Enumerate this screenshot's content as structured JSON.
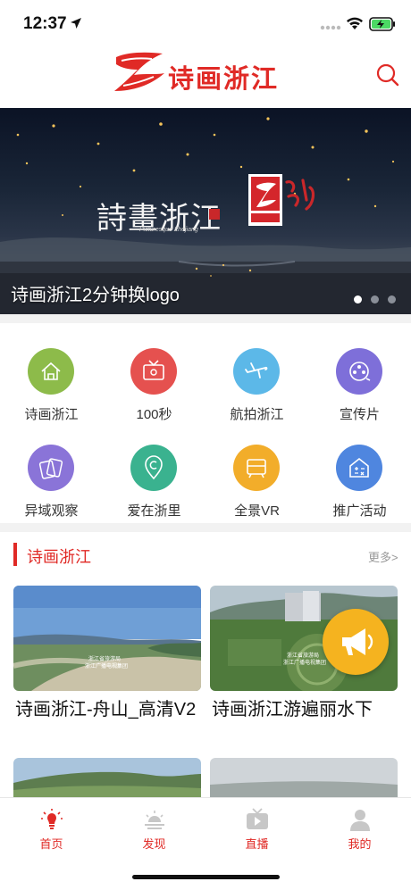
{
  "status_bar": {
    "time": "12:37"
  },
  "header": {
    "app_name": "诗画浙江"
  },
  "banner": {
    "caption": "诗画浙江2分钟换logo",
    "calligraphy": "詩畫浙江",
    "calligraphy_sub": "Picturesque Zhejiang",
    "slide_count": 3,
    "active_slide": 1
  },
  "grid": {
    "items": [
      {
        "label": "诗画浙江",
        "icon": "house-icon",
        "color": "#8dbb4a"
      },
      {
        "label": "100秒",
        "icon": "tv-icon",
        "color": "#e5514f"
      },
      {
        "label": "航拍浙江",
        "icon": "airplane-icon",
        "color": "#5cb8e8"
      },
      {
        "label": "宣传片",
        "icon": "film-reel-icon",
        "color": "#7e6fd9"
      },
      {
        "label": "异域观察",
        "icon": "cards-icon",
        "color": "#8a74d8"
      },
      {
        "label": "爱在浙里",
        "icon": "location-pin-icon",
        "color": "#3ab28f"
      },
      {
        "label": "全景VR",
        "icon": "vr-icon",
        "color": "#f2ad2a"
      },
      {
        "label": "推广活动",
        "icon": "calculator-icon",
        "color": "#4f86df"
      }
    ]
  },
  "section": {
    "title": "诗画浙江",
    "more": "更多>"
  },
  "cards": [
    {
      "title": "诗画浙江-舟山_高清V2"
    },
    {
      "title": "诗画浙江游遍丽水下"
    }
  ],
  "tabbar": {
    "items": [
      {
        "label": "首页",
        "icon": "home-lamp-icon",
        "active": true
      },
      {
        "label": "发现",
        "icon": "sunrise-icon",
        "active": false
      },
      {
        "label": "直播",
        "icon": "live-tv-icon",
        "active": false
      },
      {
        "label": "我的",
        "icon": "user-icon",
        "active": false
      }
    ]
  },
  "colors": {
    "brand_red": "#e02a26",
    "fab_yellow": "#f5b31f"
  }
}
